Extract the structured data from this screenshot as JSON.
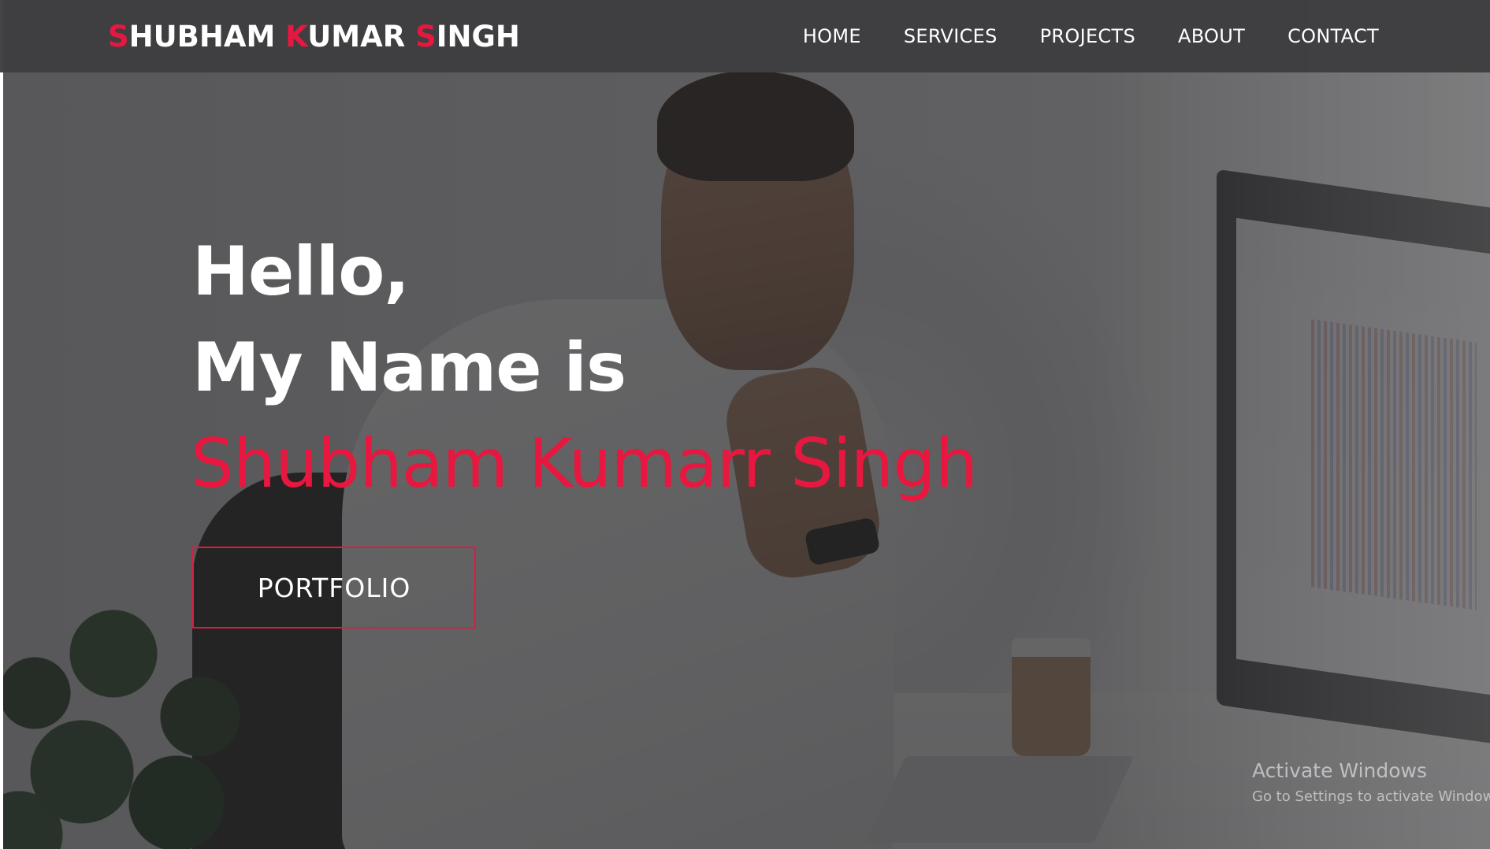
{
  "brand": {
    "first_initial": "S",
    "first_rest": "HUBHAM ",
    "middle_initial": "K",
    "middle_rest": "UMAR ",
    "last_initial": "S",
    "last_rest": "INGH"
  },
  "nav": {
    "items": [
      {
        "label": "HOME"
      },
      {
        "label": "SERVICES"
      },
      {
        "label": "PROJECTS"
      },
      {
        "label": "ABOUT"
      },
      {
        "label": "CONTACT"
      }
    ]
  },
  "hero": {
    "greeting": "Hello,",
    "intro": "My Name is",
    "name": "Shubham Kumarr Singh",
    "button_label": "PORTFOLIO"
  },
  "watermark": {
    "title": "Activate Windows",
    "subtitle": "Go to Settings to activate Windows."
  },
  "colors": {
    "accent": "#e8173f",
    "navbar": "#3e3e40",
    "text": "#ffffff"
  }
}
